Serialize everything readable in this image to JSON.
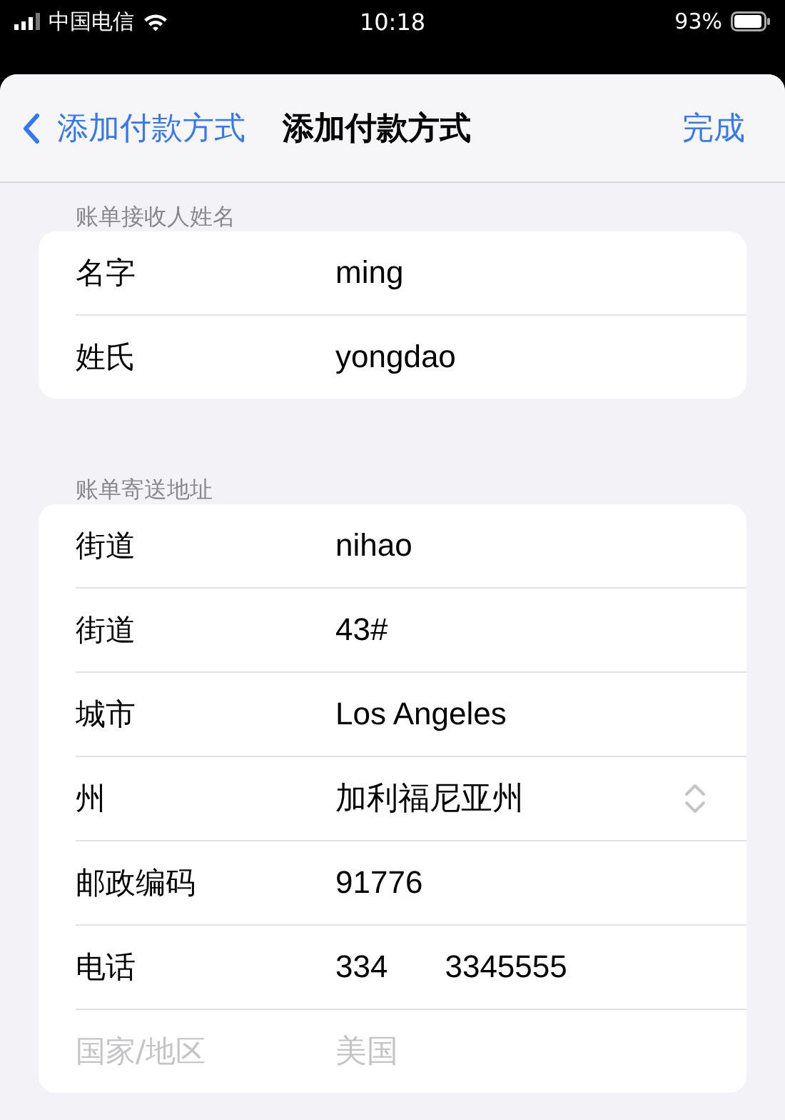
{
  "status_bar": {
    "carrier": "中国电信",
    "time": "10:18",
    "battery": "93%"
  },
  "nav": {
    "back": "添加付款方式",
    "title": "添加付款方式",
    "done": "完成"
  },
  "sections": [
    {
      "header": "账单接收人姓名",
      "rows": [
        {
          "kind": "text",
          "label": "名字",
          "values": [
            "ming"
          ],
          "disabled": false
        },
        {
          "kind": "text",
          "label": "姓氏",
          "values": [
            "yongdao"
          ],
          "disabled": false
        }
      ]
    },
    {
      "header": "账单寄送地址",
      "rows": [
        {
          "kind": "text",
          "label": "街道",
          "values": [
            "nihao"
          ],
          "disabled": false
        },
        {
          "kind": "text",
          "label": "街道",
          "values": [
            "43#"
          ],
          "disabled": false
        },
        {
          "kind": "text",
          "label": "城市",
          "values": [
            "Los Angeles"
          ],
          "disabled": false
        },
        {
          "kind": "picker",
          "label": "州",
          "values": [
            "加利福尼亚州"
          ],
          "disabled": false
        },
        {
          "kind": "text",
          "label": "邮政编码",
          "values": [
            "91776"
          ],
          "disabled": false
        },
        {
          "kind": "text",
          "label": "电话",
          "values": [
            "334",
            "3345555"
          ],
          "disabled": false
        },
        {
          "kind": "text",
          "label": "国家/地区",
          "values": [
            "美国"
          ],
          "disabled": true
        }
      ]
    }
  ]
}
